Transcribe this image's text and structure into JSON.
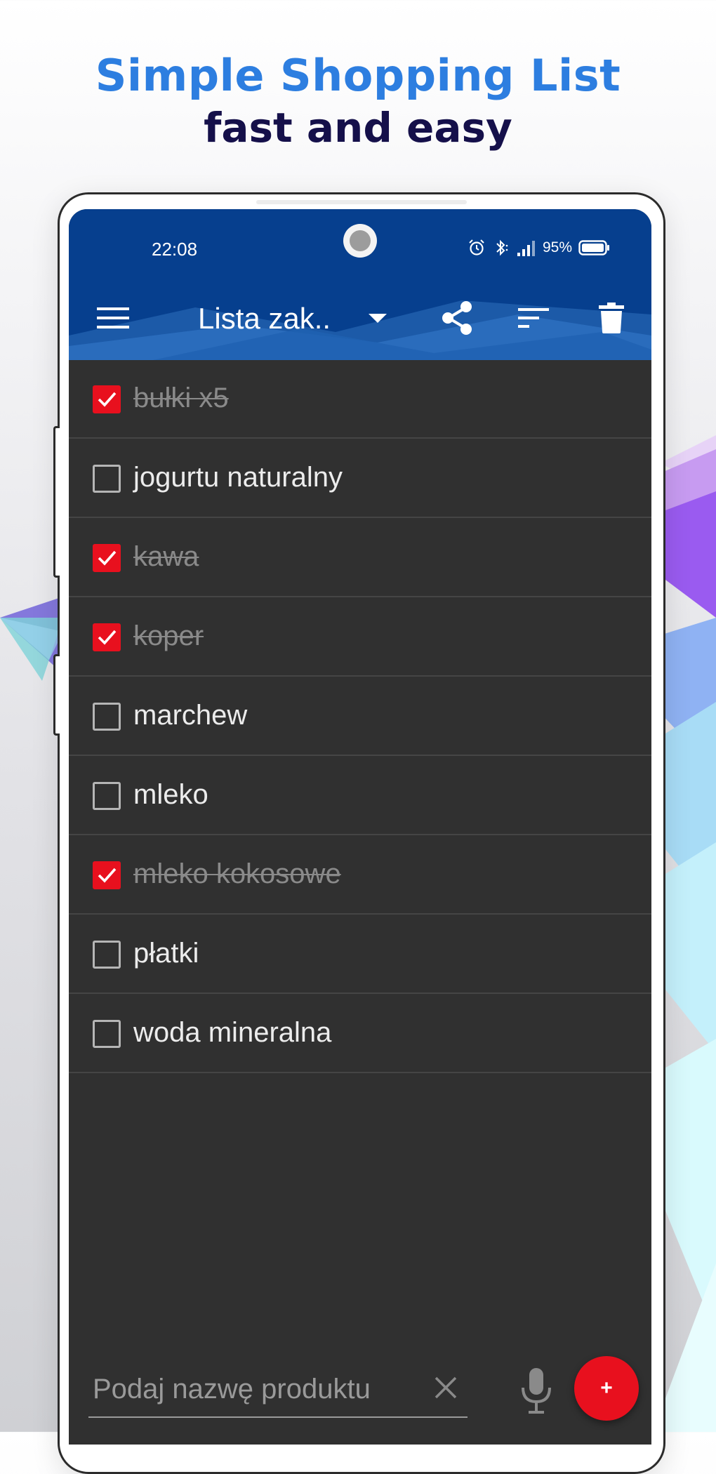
{
  "hero": {
    "title": "Simple Shopping List",
    "subtitle": "fast and easy"
  },
  "colors": {
    "title": "#2d7ee0",
    "subtitle": "#15104a",
    "toolbar": "#063f8e",
    "list_background": "#303030",
    "accent_red": "#e8101e",
    "divider": "#454545"
  },
  "status_bar": {
    "time": "22:08",
    "battery": "95%",
    "icons": [
      "alarm-icon",
      "bluetooth-icon",
      "signal-icon",
      "battery-icon"
    ]
  },
  "toolbar": {
    "list_name": "Lista zak..",
    "icons": [
      "menu-icon",
      "dropdown-arrow-icon",
      "share-icon",
      "sort-icon",
      "trash-icon"
    ]
  },
  "items": [
    {
      "label": "bułki x5",
      "checked": true
    },
    {
      "label": "jogurtu naturalny",
      "checked": false
    },
    {
      "label": "kawa",
      "checked": true
    },
    {
      "label": "koper",
      "checked": true
    },
    {
      "label": "marchew",
      "checked": false
    },
    {
      "label": "mleko",
      "checked": false
    },
    {
      "label": "mleko kokosowe",
      "checked": true
    },
    {
      "label": "płatki",
      "checked": false
    },
    {
      "label": "woda mineralna",
      "checked": false
    }
  ],
  "input": {
    "placeholder": "Podaj nazwę produktu",
    "value": ""
  },
  "fab": {
    "label": "+"
  }
}
